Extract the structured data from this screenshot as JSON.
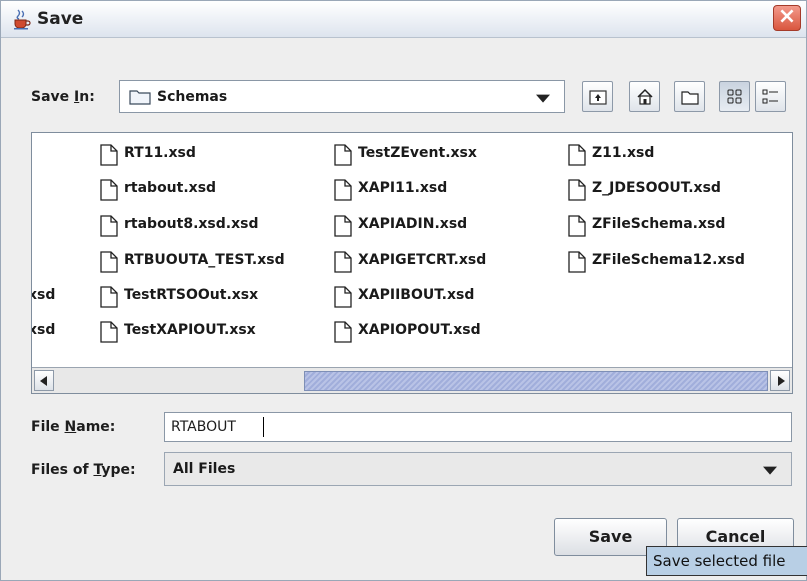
{
  "window": {
    "title": "Save"
  },
  "save_in": {
    "label": "Save In:",
    "mnemonic": "I",
    "value": "Schemas"
  },
  "toolbar": {
    "up_icon": "up-one-level-icon",
    "home_icon": "home-icon",
    "new_folder_icon": "new-folder-icon",
    "list_icon": "list-view-icon",
    "details_icon": "details-view-icon"
  },
  "files": {
    "column0": [
      "xsd",
      "xsd"
    ],
    "column1": [
      "RT11.xsd",
      "rtabout.xsd",
      "rtabout8.xsd.xsd",
      "RTBUOUTA_TEST.xsd",
      "TestRTSOOut.xsx",
      "TestXAPIOUT.xsx"
    ],
    "column2": [
      "TestZEvent.xsx",
      "XAPI11.xsd",
      "XAPIADIN.xsd",
      "XAPIGETCRT.xsd",
      "XAPIIBOUT.xsd",
      "XAPIOPOUT.xsd"
    ],
    "column3": [
      "Z11.xsd",
      "Z_JDESOOUT.xsd",
      "ZFileSchema.xsd",
      "ZFileSchema12.xsd"
    ]
  },
  "file_name": {
    "label": "File Name:",
    "mnemonic": "N",
    "value": "RTABOUT"
  },
  "files_of_type": {
    "label": "Files of Type:",
    "mnemonic": "T",
    "value": "All Files"
  },
  "buttons": {
    "save": "Save",
    "cancel": "Cancel"
  },
  "tooltip": "Save selected file",
  "colors": {
    "title_bar": "#dde4ee",
    "close_button": "#d9563e",
    "scroll_thumb": "#a1aedb",
    "tooltip_bg": "#b8cfe5"
  }
}
